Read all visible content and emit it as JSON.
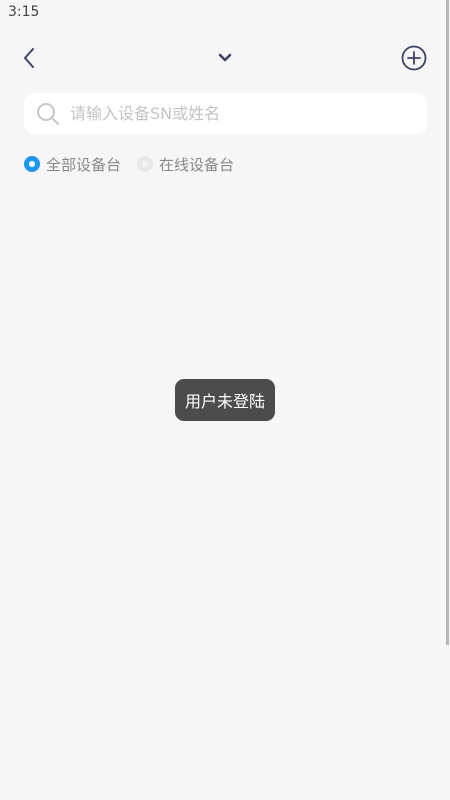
{
  "status_bar": {
    "time": "3:15"
  },
  "header": {
    "back_icon": "chevron-left-icon",
    "dropdown_icon": "chevron-down-icon",
    "add_icon": "plus-circle-icon",
    "icon_color": "#3d4266"
  },
  "search": {
    "placeholder": "请输入设备SN或姓名",
    "value": ""
  },
  "filter": {
    "options": [
      {
        "label": "全部设备台",
        "selected": true
      },
      {
        "label": "在线设备台",
        "selected": false
      }
    ],
    "accent_color": "#1e96f0"
  },
  "toast": {
    "message": "用户未登陆"
  },
  "scroll": {
    "visible_fraction": 0.81
  }
}
